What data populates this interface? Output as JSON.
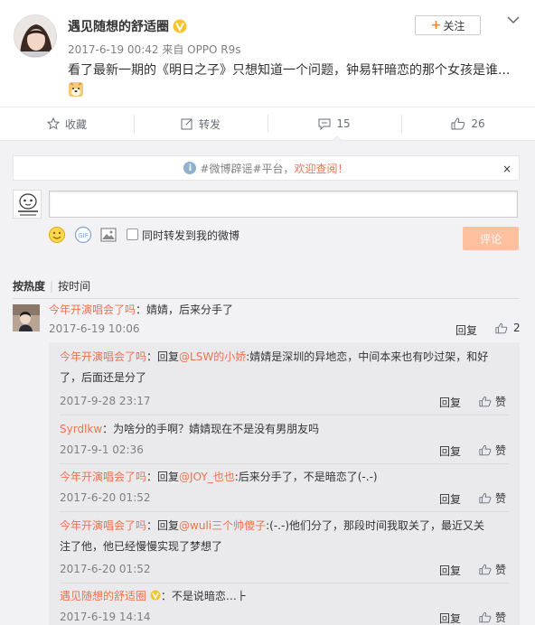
{
  "post": {
    "author": "遇见随想的舒适圈",
    "meta": "2017-6-19 00:42 来自 OPPO R9s",
    "text": "看了最新一期的《明日之子》只想知道一个问题，钟易轩暗恋的那个女孩是谁...",
    "follow_label": "关注",
    "follow_plus": "+",
    "accent_color": "#ff8140"
  },
  "actions": [
    {
      "label": "收藏",
      "icon": "star-icon"
    },
    {
      "label": "转发",
      "icon": "forward-icon"
    },
    {
      "label": "15",
      "icon": "comment-icon"
    },
    {
      "label": "26",
      "icon": "thumbs-up-icon"
    }
  ],
  "notice": {
    "info_glyph": "i",
    "text": "#微博辟谣#平台，",
    "link": "欢迎查阅！",
    "close": "×"
  },
  "composer": {
    "forward_label": "同时转发到我的微博",
    "submit_label": "评论"
  },
  "sort": {
    "hot": "按热度",
    "sep": "|",
    "time": "按时间"
  },
  "comment": {
    "user": "今年开演唱会了吗",
    "text": "：婧婧，后来分手了",
    "time": "2017-6-19 10:06",
    "reply_label": "回复",
    "likes": "2"
  },
  "replies": [
    {
      "user": "今年开演唱会了吗",
      "pre": "：回复",
      "mention": "@LSW的小娇",
      "body": ":婧婧是深圳的异地恋，中间本来也有吵过架，和好了，后面还是分了",
      "time": "2017-9-28 23:17",
      "reply_label": "回复",
      "like_label": "赞"
    },
    {
      "user": "Syrdlkw",
      "pre": "：为啥分的手啊？婧婧现在不是没有男朋友吗",
      "mention": "",
      "body": "",
      "time": "2017-9-1 02:36",
      "reply_label": "回复",
      "like_label": "赞"
    },
    {
      "user": "今年开演唱会了吗",
      "pre": "：回复",
      "mention": "@JOY_也也",
      "body": ":后来分手了，不是暗恋了(-.-)",
      "time": "2017-6-20 01:52",
      "reply_label": "回复",
      "like_label": "赞"
    },
    {
      "user": "今年开演唱会了吗",
      "pre": "：回复",
      "mention": "@wuli三个帅傻子",
      "body": ":(-.-)他们分了，那段时间我取关了，最近又关注了他，他已经慢慢实现了梦想了",
      "time": "2017-6-20 01:52",
      "reply_label": "回复",
      "like_label": "赞"
    },
    {
      "user": "遇见随想的舒适圈",
      "pre": "：不是说暗恋…⺊",
      "mention": "",
      "body": "",
      "time": "2017-6-19 14:14",
      "reply_label": "回复",
      "like_label": "赞"
    }
  ],
  "colors": {
    "username": "#eb7350",
    "submit_disabled": "#ffc09f",
    "comment_bg": "#f2f2f5",
    "reply_bg": "#eaeaec"
  }
}
